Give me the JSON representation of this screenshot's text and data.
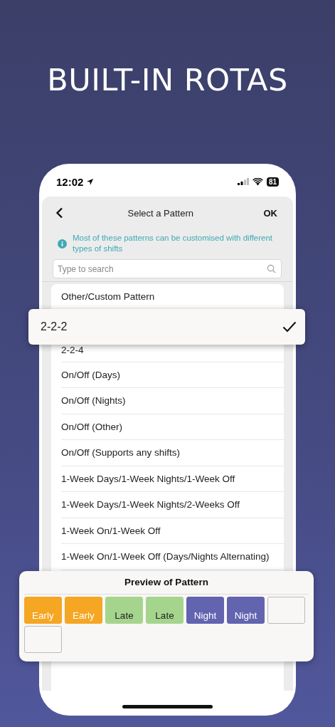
{
  "headline": "BUILT-IN ROTAS",
  "status_bar": {
    "time": "12:02",
    "battery": "81"
  },
  "header": {
    "title": "Select a Pattern",
    "ok": "OK"
  },
  "info": "Most of these patterns can be customised with different types of shifts",
  "search": {
    "placeholder": "Type to search"
  },
  "patterns": [
    {
      "label": "Other/Custom Pattern",
      "selected": false
    },
    {
      "label": "2-2-2",
      "selected": true
    },
    {
      "label": "2-2-4",
      "selected": false
    },
    {
      "label": "On/Off (Days)",
      "selected": false
    },
    {
      "label": "On/Off (Nights)",
      "selected": false
    },
    {
      "label": "On/Off (Other)",
      "selected": false
    },
    {
      "label": "On/Off (Supports any shifts)",
      "selected": false
    },
    {
      "label": "1-Week Days/1-Week Nights/1-Week Off",
      "selected": false
    },
    {
      "label": "1-Week Days/1-Week Nights/2-Weeks Off",
      "selected": false
    },
    {
      "label": "1-Week On/1-Week Off",
      "selected": false
    },
    {
      "label": "1-Week On/1-Week Off (Days/Nights Alternating)",
      "selected": false
    }
  ],
  "preview": {
    "title": "Preview of Pattern",
    "cells": [
      {
        "kind": "shift",
        "label": "Early",
        "color": "#f5a623"
      },
      {
        "kind": "shift",
        "label": "Early",
        "color": "#f5a623"
      },
      {
        "kind": "shift",
        "label": "Late",
        "color": "#a5d58d"
      },
      {
        "kind": "shift",
        "label": "Late",
        "color": "#a5d58d"
      },
      {
        "kind": "shift",
        "label": "Night",
        "color": "#6264b0"
      },
      {
        "kind": "shift",
        "label": "Night",
        "color": "#6264b0"
      },
      {
        "kind": "empty"
      },
      {
        "kind": "empty"
      }
    ]
  }
}
